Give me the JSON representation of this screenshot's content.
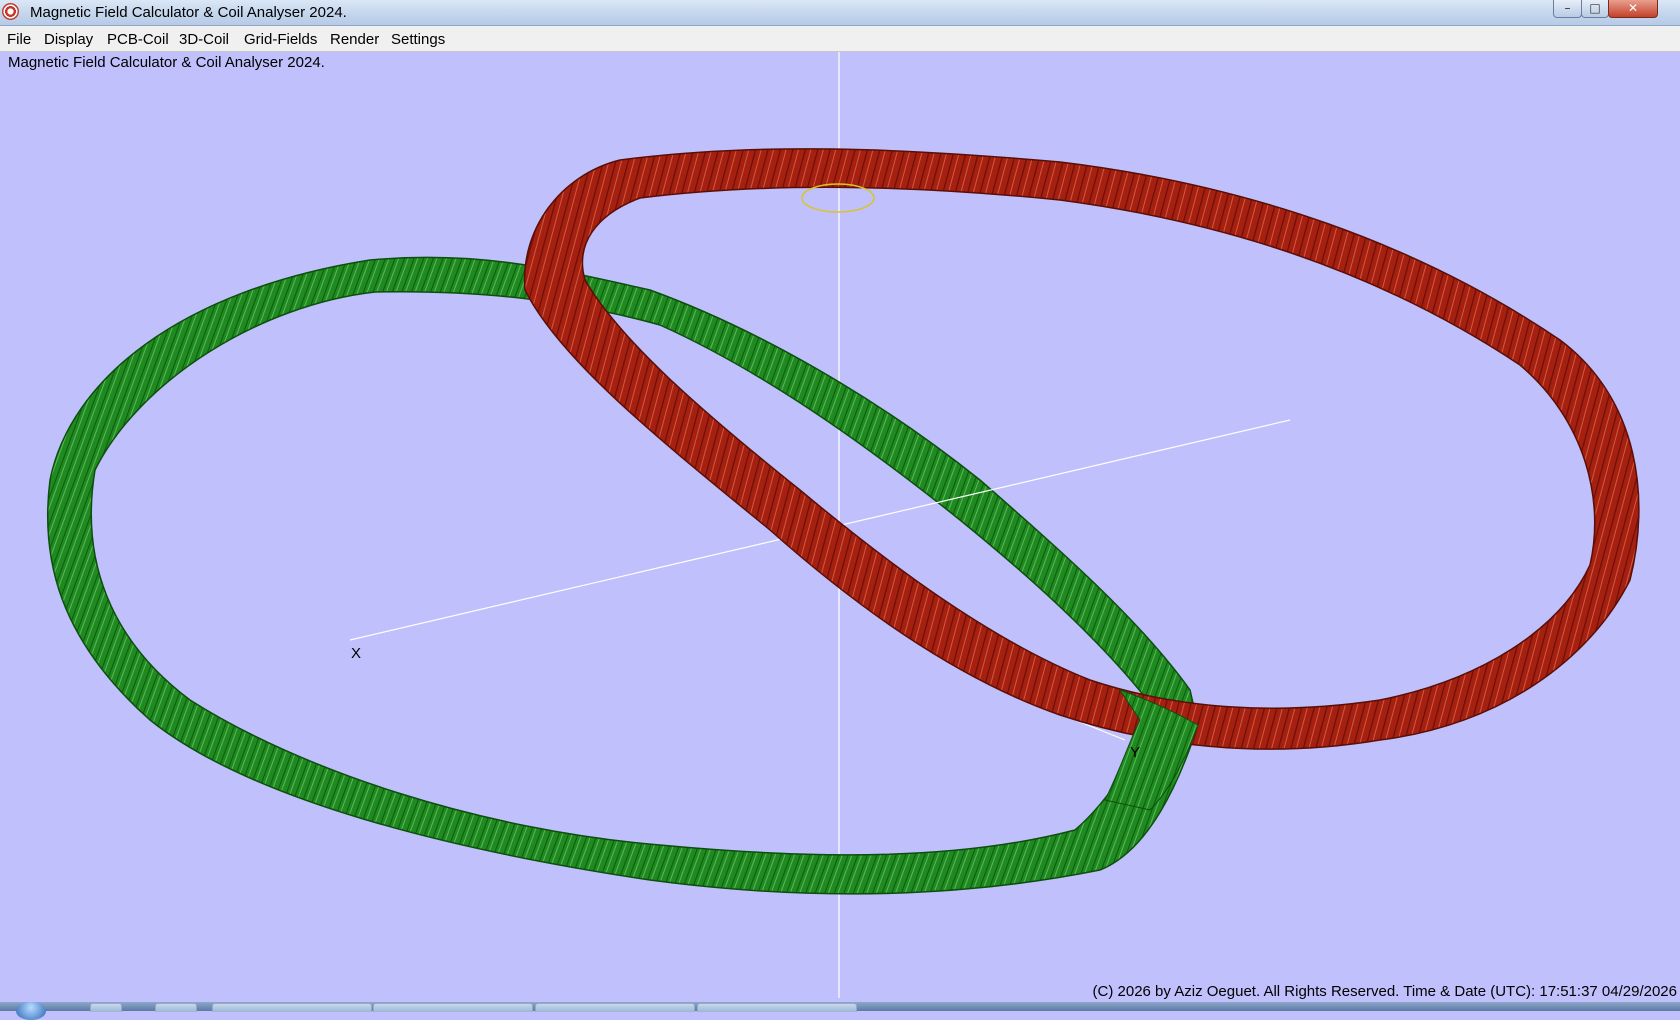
{
  "window": {
    "title": "Magnetic Field Calculator & Coil Analyser 2024.",
    "controls": {
      "minimize": "–",
      "maximize": "□",
      "close": "✕"
    }
  },
  "menu": {
    "items": [
      "File",
      "Display",
      "PCB-Coil",
      "3D-Coil",
      "Grid-Fields",
      "Render",
      "Settings"
    ]
  },
  "viewport": {
    "background_color": "#c0c0fc",
    "status_top": "Magnetic Field Calculator & Coil Analyser 2024.",
    "status_bottom": "(C) 2026  by Aziz Oeguet. All Rights Reserved.  Time & Date (UTC): 17:51:37  04/29/2026",
    "axes": {
      "x_label": "X",
      "y_label": "Y"
    },
    "coils": [
      {
        "name": "green",
        "color": "#1f8a1f"
      },
      {
        "name": "red",
        "color": "#a52010"
      }
    ],
    "marker_color": "#d8c428"
  },
  "taskbar": {
    "icons": [
      "start-orb-icon",
      "show-desktop-icon",
      "folder-icon",
      "app-task-icon"
    ]
  }
}
